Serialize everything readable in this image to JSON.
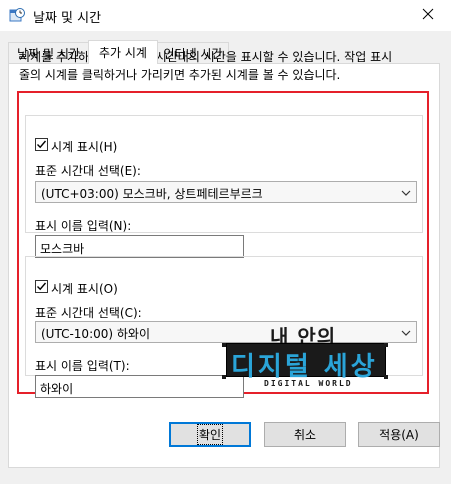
{
  "window": {
    "title": "날짜 및 시간",
    "icon": "clock-calendar-icon"
  },
  "tabs": [
    {
      "label": "날짜 및 시간",
      "active": false
    },
    {
      "label": "추가 시계",
      "active": true
    },
    {
      "label": "인터넷 시간",
      "active": false
    }
  ],
  "description": {
    "line1": "시계를 추가하여 다른 표준 시간대의 시간을 표시할 수 있습니다. 작업 표시",
    "line2": "줄의 시계를 클릭하거나 가리키면 추가된 시계를 볼 수 있습니다."
  },
  "clock1": {
    "show_label": "시계 표시(H)",
    "checked": true,
    "timezone_label": "표준 시간대 선택(E):",
    "timezone_value": "(UTC+03:00) 모스크바, 상트페테르부르크",
    "name_label": "표시 이름 입력(N):",
    "name_value": "모스크바"
  },
  "clock2": {
    "show_label": "시계 표시(O)",
    "checked": true,
    "timezone_label": "표준 시간대 선택(C):",
    "timezone_value": "(UTC-10:00) 하와이",
    "name_label": "표시 이름 입력(T):",
    "name_value": "하와이"
  },
  "watermark": {
    "top": "내 안의",
    "main": "디지털 세상",
    "sub": "DIGITAL WORLD"
  },
  "buttons": {
    "ok": "확인",
    "cancel": "취소",
    "apply": "적용(A)"
  },
  "colors": {
    "highlight_frame": "#e5202a",
    "watermark_accent": "#2aa4d8",
    "default_button_border": "#0078d7"
  }
}
